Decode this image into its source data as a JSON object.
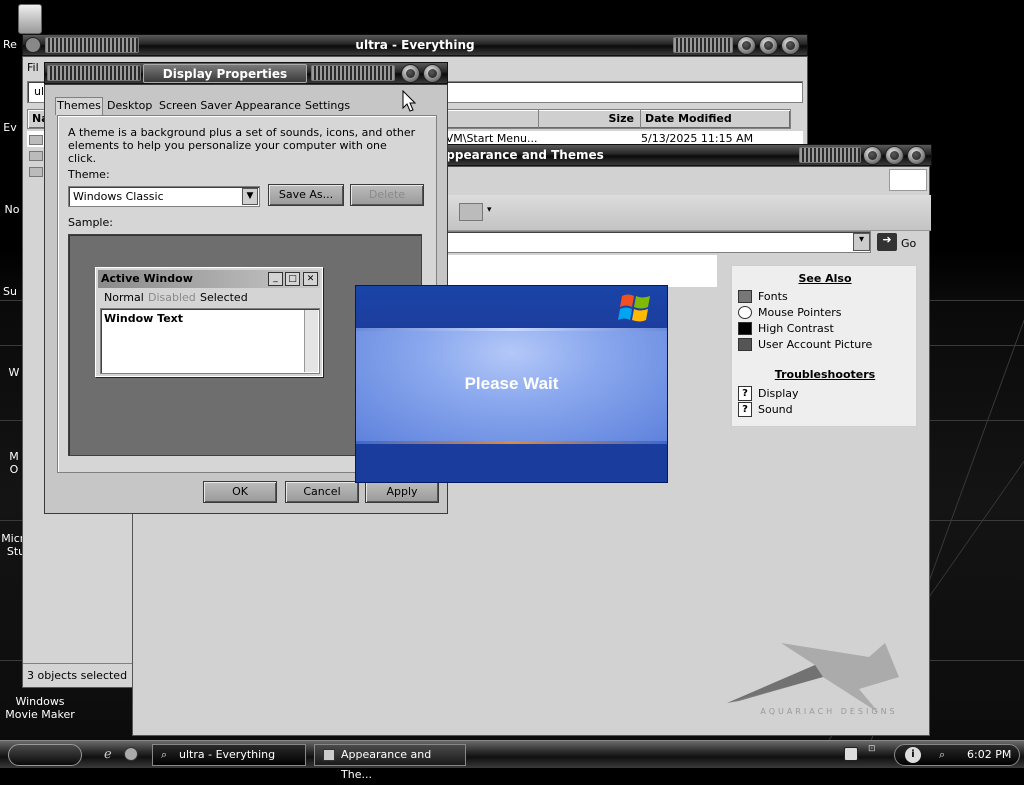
{
  "desktop": {
    "icons": [
      {
        "label": "Re",
        "name": "desktop-icon-recycle"
      },
      {
        "label": "Ev",
        "name": "desktop-icon-ev"
      },
      {
        "label": "No",
        "name": "desktop-icon-no"
      },
      {
        "label": "Su",
        "name": "desktop-icon-su"
      },
      {
        "label": "W",
        "name": "desktop-icon-w"
      },
      {
        "label": "M\nO",
        "name": "desktop-icon-mo"
      },
      {
        "label": "Micro\nStu",
        "name": "desktop-icon-micro"
      },
      {
        "label": "Windows Movie Maker",
        "name": "desktop-icon-movie-maker"
      }
    ]
  },
  "everything": {
    "title": "ultra - Everything",
    "menu_first": "Fil",
    "search_value": "ult",
    "col_name": "Na",
    "col_size": "Size",
    "col_modified": "Date Modified",
    "row_path": "oVM\\Start Menu...",
    "row_date": "5/13/2025 11:15 AM",
    "status": "3 objects selected"
  },
  "appearance": {
    "title": "Appearance and Themes",
    "address_go": "Go",
    "see_also_title": "See Also",
    "see_also": [
      "Fonts",
      "Mouse Pointers",
      "High Contrast",
      "User Account Picture"
    ],
    "troubleshooters_title": "Troubleshooters",
    "troubleshooters": [
      "Display",
      "Sound"
    ],
    "logo_text": "AQUARIACH DESIGNS"
  },
  "display": {
    "title": "Display Properties",
    "tabs": [
      "Themes",
      "Desktop",
      "Screen Saver",
      "Appearance",
      "Settings"
    ],
    "description": "A theme is a background plus a set of sounds, icons, and other elements to help you personalize your computer with one click.",
    "theme_label": "Theme:",
    "theme_value": "Windows Classic",
    "save_as": "Save As...",
    "delete": "Delete",
    "sample_label": "Sample:",
    "sample": {
      "title": "Active Window",
      "menu": [
        "Normal",
        "Disabled",
        "Selected"
      ],
      "text": "Window Text"
    },
    "ok": "OK",
    "cancel": "Cancel",
    "apply": "Apply"
  },
  "please_wait": {
    "text": "Please Wait"
  },
  "taskbar": {
    "tasks": [
      "ultra - Everything",
      "Appearance and The..."
    ],
    "clock": "6:02 PM"
  },
  "colors": {
    "xp_blue": "#1a3c9c",
    "xp_light": "#8aa8ee",
    "metal": "#2a2a2a"
  }
}
